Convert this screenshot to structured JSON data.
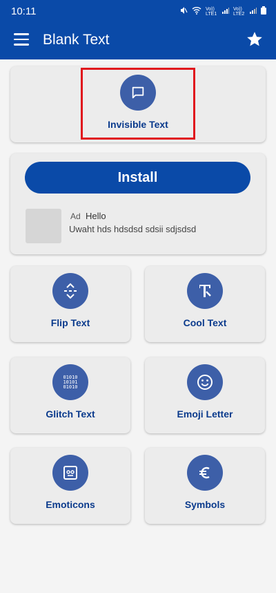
{
  "status": {
    "time": "10:11",
    "sim1": "Vo)) LTE1",
    "sim2": "Vo)) LTE2"
  },
  "app_bar": {
    "title": "Blank Text"
  },
  "tiles": {
    "invisible": "Invisible Text",
    "flip": "Flip Text",
    "cool": "Cool Text",
    "glitch": "Glitch Text",
    "emoji": "Emoji Letter",
    "emoticons": "Emoticons",
    "symbols": "Symbols"
  },
  "ad": {
    "button": "Install",
    "badge": "Ad",
    "title": "Hello",
    "body": "Uwaht hds hdsdsd sdsii sdjsdsd"
  },
  "colors": {
    "primary": "#0a4aa8",
    "icon_circle": "#3d5fa8",
    "label": "#0a3a8c",
    "highlight": "#e0141c"
  }
}
